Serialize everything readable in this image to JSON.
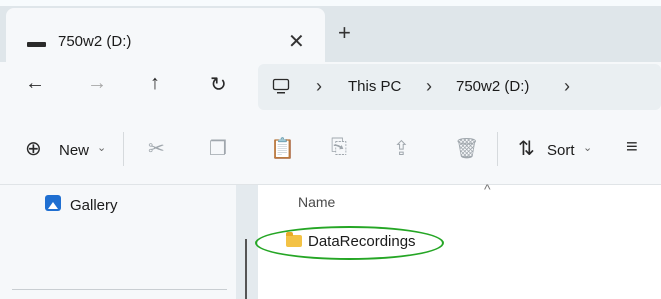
{
  "tab": {
    "title": "750w2 (D:)",
    "close": "✕",
    "new_tab": "+"
  },
  "nav": {
    "back": "←",
    "forward": "→",
    "up": "↑",
    "refresh": "↻"
  },
  "breadcrumb": {
    "computer_icon": "computer-icon",
    "items": [
      "This PC",
      "750w2 (D:)"
    ],
    "separator": "›"
  },
  "toolbar": {
    "new_label": "New",
    "sort_label": "Sort",
    "caret": "⌄"
  },
  "sidebar": {
    "items": [
      {
        "label": "Gallery",
        "icon": "gallery-icon"
      }
    ]
  },
  "content": {
    "column_name": "Name",
    "sort_indicator": "^",
    "items": [
      {
        "label": "DataRecordings",
        "icon": "folder-icon"
      }
    ]
  },
  "colors": {
    "accent": "#1f6fd1",
    "highlight": "#25a625",
    "folder": "#f3c245"
  }
}
